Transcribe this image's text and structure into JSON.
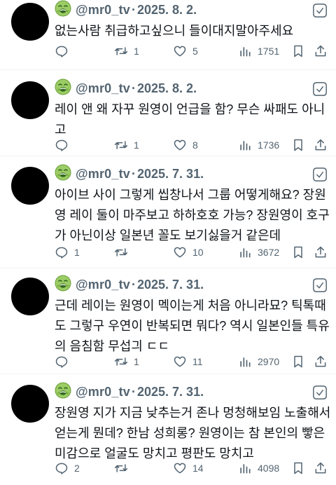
{
  "tweets": [
    {
      "handle": "@mr0_tv",
      "date": "2025. 8. 2.",
      "lines": [
        "없는사람 취급하고싶으니 들이대지말아주세요"
      ],
      "replies": "",
      "retweets": "1",
      "likes": "5",
      "views": "1751"
    },
    {
      "handle": "@mr0_tv",
      "date": "2025. 8. 2.",
      "lines": [
        "레이 앤 왜 자꾸 원영이 언급을 함? 무슨 싸패도 아니",
        "고"
      ],
      "replies": "",
      "retweets": "1",
      "likes": "8",
      "views": "1736"
    },
    {
      "handle": "@mr0_tv",
      "date": "2025. 7. 31.",
      "lines": [
        "아이브 사이 그렇게 씹창나서 그룹 어떻게해요? 장원",
        "영 레이 둘이 마주보고 하하호호 가능? 장원영이 호구",
        "가 아닌이상 일본년 꼴도 보기싫을거 같은데"
      ],
      "replies": "1",
      "retweets": "",
      "likes": "10",
      "views": "3672"
    },
    {
      "handle": "@mr0_tv",
      "date": "2025. 7. 31.",
      "lines": [
        "근데 레이는 원영이 멕이는게 처음 아니라묘? 틱톡때",
        "도 그렇구 우연이 반복되면 뭐다? 역시 일본인들 특유",
        "의 음침함 무섭긔 ㄷㄷ"
      ],
      "replies": "",
      "retweets": "1",
      "likes": "11",
      "views": "2970"
    },
    {
      "handle": "@mr0_tv",
      "date": "2025. 7. 31.",
      "lines": [
        "장원영 지가 지금 낮추는거 존나 멍청해보임 노출해서",
        "얻는게 뭔데? 한남 성희롱? 원영이는 참 본인의 빻은",
        "미감으로 얼굴도 망치고 평판도 망치고"
      ],
      "replies": "2",
      "retweets": "",
      "likes": "14",
      "views": "4098"
    }
  ],
  "icons": {
    "reply": "reply-icon",
    "retweet": "retweet-icon",
    "like": "heart-icon",
    "views": "views-icon",
    "bookmark": "bookmark-icon",
    "share": "share-icon",
    "emoji": "nauseated-face-emoji-icon",
    "more": "more-options-icon"
  },
  "colors": {
    "text": "#0f1419",
    "muted": "#536471",
    "emoji_green": "#8bc34a"
  }
}
